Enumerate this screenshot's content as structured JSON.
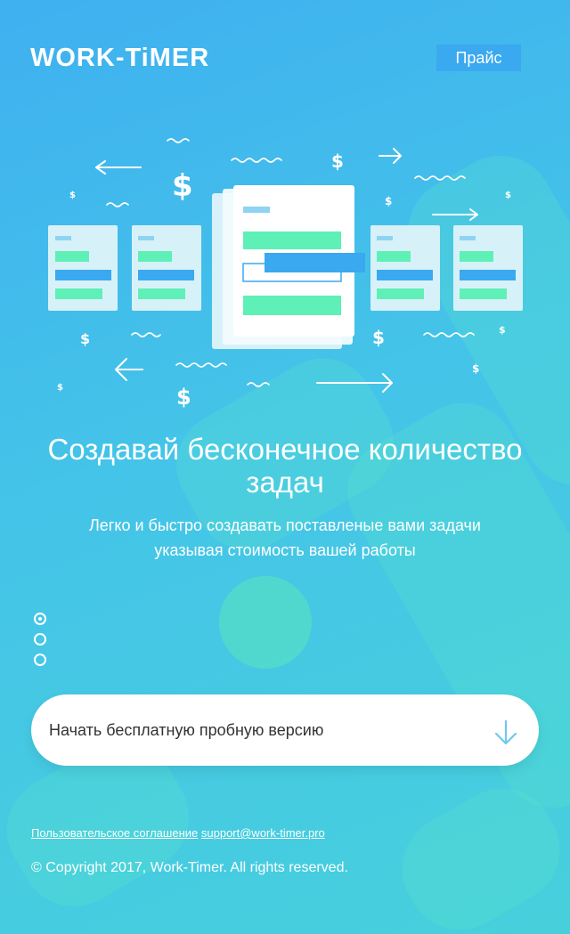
{
  "header": {
    "logo_text": "WORK-TiMER",
    "price_label": "Прайс"
  },
  "hero": {
    "title": "Создавай бесконечное количество задач",
    "subtitle_line1": "Легко и быстро создавать поставленые вами задачи",
    "subtitle_line2": "указывая стоимость вашей работы"
  },
  "slider": {
    "dots": [
      "slide-1",
      "slide-2",
      "slide-3"
    ],
    "active_index": 0
  },
  "cta": {
    "label": "Начать бесплатную пробную версию",
    "icon": "arrow-down-icon"
  },
  "footer": {
    "agreement_link": "Пользовательское соглашение",
    "email_link": "support@work-timer.pro",
    "copyright": "© Copyright 2017, Work-Timer. All rights reserved."
  },
  "colors": {
    "background": "#44c4e8",
    "price_button": "#3aa9f0",
    "accent_green": "#5ff0b8",
    "accent_blue": "#3aa9f0"
  }
}
